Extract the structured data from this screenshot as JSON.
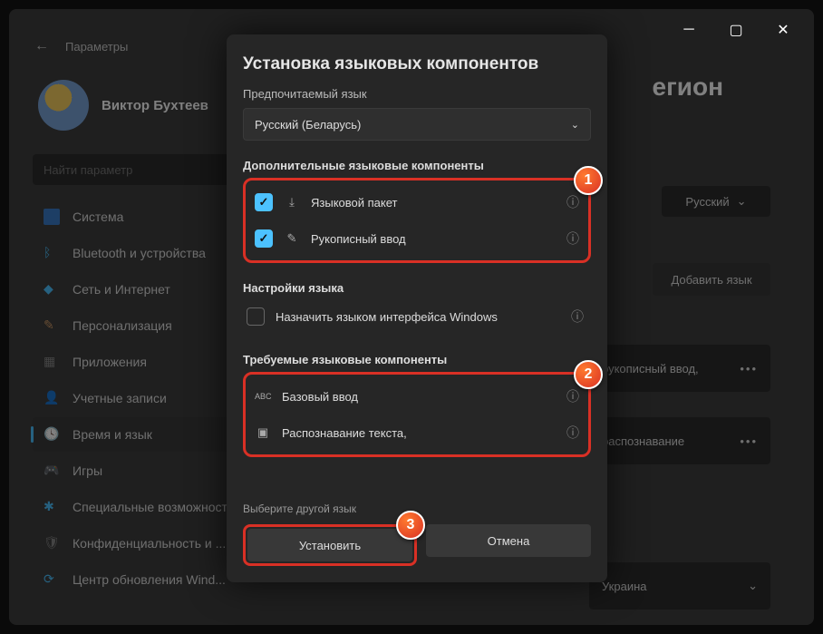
{
  "window": {
    "back_label": "Параметры"
  },
  "profile": {
    "name": "Виктор Бухтеев",
    "sub": ""
  },
  "search": {
    "placeholder": "Найти параметр"
  },
  "sidebar": {
    "items": [
      {
        "label": "Система"
      },
      {
        "label": "Bluetooth и устройства"
      },
      {
        "label": "Сеть и Интернет"
      },
      {
        "label": "Персонализация"
      },
      {
        "label": "Приложения"
      },
      {
        "label": "Учетные записи"
      },
      {
        "label": "Время и язык"
      },
      {
        "label": "Игры"
      },
      {
        "label": "Специальные возможности"
      },
      {
        "label": "Конфиденциальность и ..."
      },
      {
        "label": "Центр обновления Wind..."
      }
    ],
    "active_index": 6
  },
  "content": {
    "title_fragment": "егион",
    "lang_select": "Русский",
    "add_lang": "Добавить язык",
    "row1": "рукописный ввод,",
    "row2": "распознавание",
    "row3": "Украина",
    "dots": "•••"
  },
  "dialog": {
    "title": "Установка языковых компонентов",
    "preferred_label": "Предпочитаемый язык",
    "preferred_value": "Русский (Беларусь)",
    "section_optional": "Дополнительные языковые компоненты",
    "opt_pack": "Языковой пакет",
    "opt_handwriting": "Рукописный ввод",
    "section_settings": "Настройки языка",
    "opt_display": "Назначить языком интерфейса Windows",
    "section_required": "Требуемые языковые компоненты",
    "req_basic": "Базовый ввод",
    "req_ocr": "Распознавание текста,",
    "choose_other": "Выберите другой язык",
    "install": "Установить",
    "cancel": "Отмена",
    "badges": {
      "b1": "1",
      "b2": "2",
      "b3": "3"
    }
  }
}
